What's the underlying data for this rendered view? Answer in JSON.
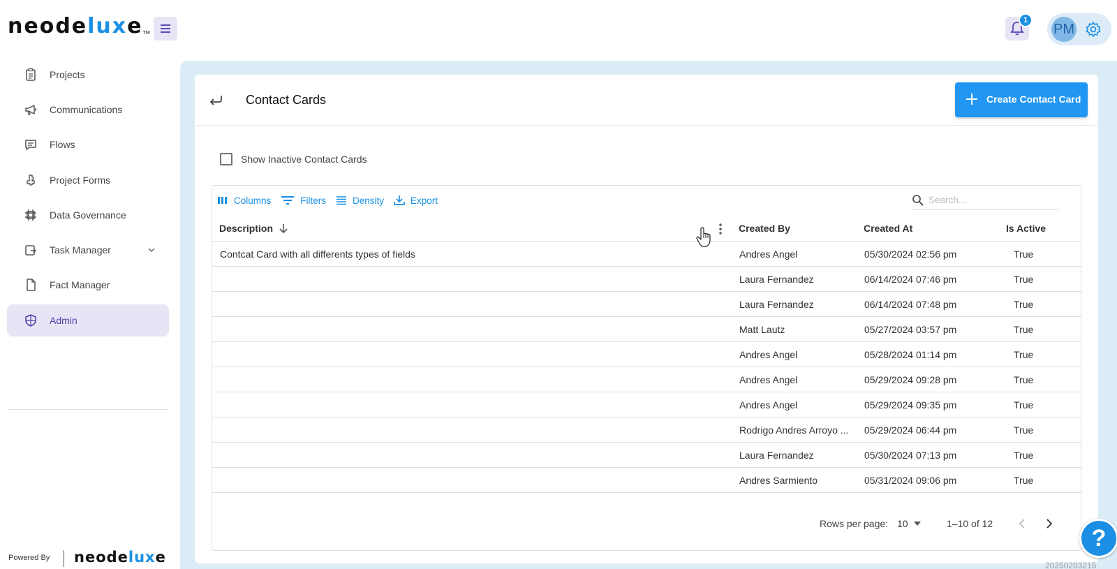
{
  "brand": {
    "logo_prefix": "neode",
    "logo_accent": "lux",
    "logo_suffix": "e",
    "trademark": "TM",
    "accent_color": "#1a8fe3"
  },
  "header": {
    "notification_count": "1",
    "user_initials": "PM"
  },
  "sidebar": {
    "items": [
      {
        "label": "Projects",
        "icon": "clipboard-icon"
      },
      {
        "label": "Communications",
        "icon": "megaphone-icon"
      },
      {
        "label": "Flows",
        "icon": "message-square-icon"
      },
      {
        "label": "Project Forms",
        "icon": "puzzle-icon"
      },
      {
        "label": "Data Governance",
        "icon": "grid-icon"
      },
      {
        "label": "Task Manager",
        "icon": "task-icon"
      },
      {
        "label": "Fact Manager",
        "icon": "file-icon"
      },
      {
        "label": "Admin",
        "icon": "shield-icon"
      }
    ],
    "active_item": "Admin",
    "powered_by": "Powered By"
  },
  "page": {
    "title": "Contact Cards",
    "create_button": "Create Contact Card",
    "show_inactive_label": "Show Inactive Contact Cards"
  },
  "grid": {
    "toolbar": {
      "columns": "Columns",
      "filters": "Filters",
      "density": "Density",
      "export": "Export",
      "search_placeholder": "Search..."
    },
    "columns": [
      "Description",
      "Created By",
      "Created At",
      "Is Active"
    ],
    "rows": [
      {
        "description": "Contcat Card with all differents types of fields",
        "created_by": "Andres Angel",
        "created_at": "05/30/2024 02:56 pm",
        "is_active": "True"
      },
      {
        "description": "",
        "created_by": "Laura Fernandez",
        "created_at": "06/14/2024 07:46 pm",
        "is_active": "True"
      },
      {
        "description": "",
        "created_by": "Laura Fernandez",
        "created_at": "06/14/2024 07:48 pm",
        "is_active": "True"
      },
      {
        "description": "",
        "created_by": "Matt Lautz",
        "created_at": "05/27/2024 03:57 pm",
        "is_active": "True"
      },
      {
        "description": "",
        "created_by": "Andres Angel",
        "created_at": "05/28/2024 01:14 pm",
        "is_active": "True"
      },
      {
        "description": "",
        "created_by": "Andres Angel",
        "created_at": "05/29/2024 09:28 pm",
        "is_active": "True"
      },
      {
        "description": "",
        "created_by": "Andres Angel",
        "created_at": "05/29/2024 09:35 pm",
        "is_active": "True"
      },
      {
        "description": "",
        "created_by": "Rodrigo Andres Arroyo ...",
        "created_at": "05/29/2024 06:44 pm",
        "is_active": "True"
      },
      {
        "description": "",
        "created_by": "Laura Fernandez",
        "created_at": "05/30/2024 07:13 pm",
        "is_active": "True"
      },
      {
        "description": "",
        "created_by": "Andres Sarmiento",
        "created_at": "05/31/2024 09:06 pm",
        "is_active": "True"
      }
    ],
    "footer": {
      "rows_per_page_label": "Rows per page:",
      "rows_per_page_value": "10",
      "range": "1–10 of 12"
    }
  },
  "help_label": "?",
  "build_id": "20250203215"
}
